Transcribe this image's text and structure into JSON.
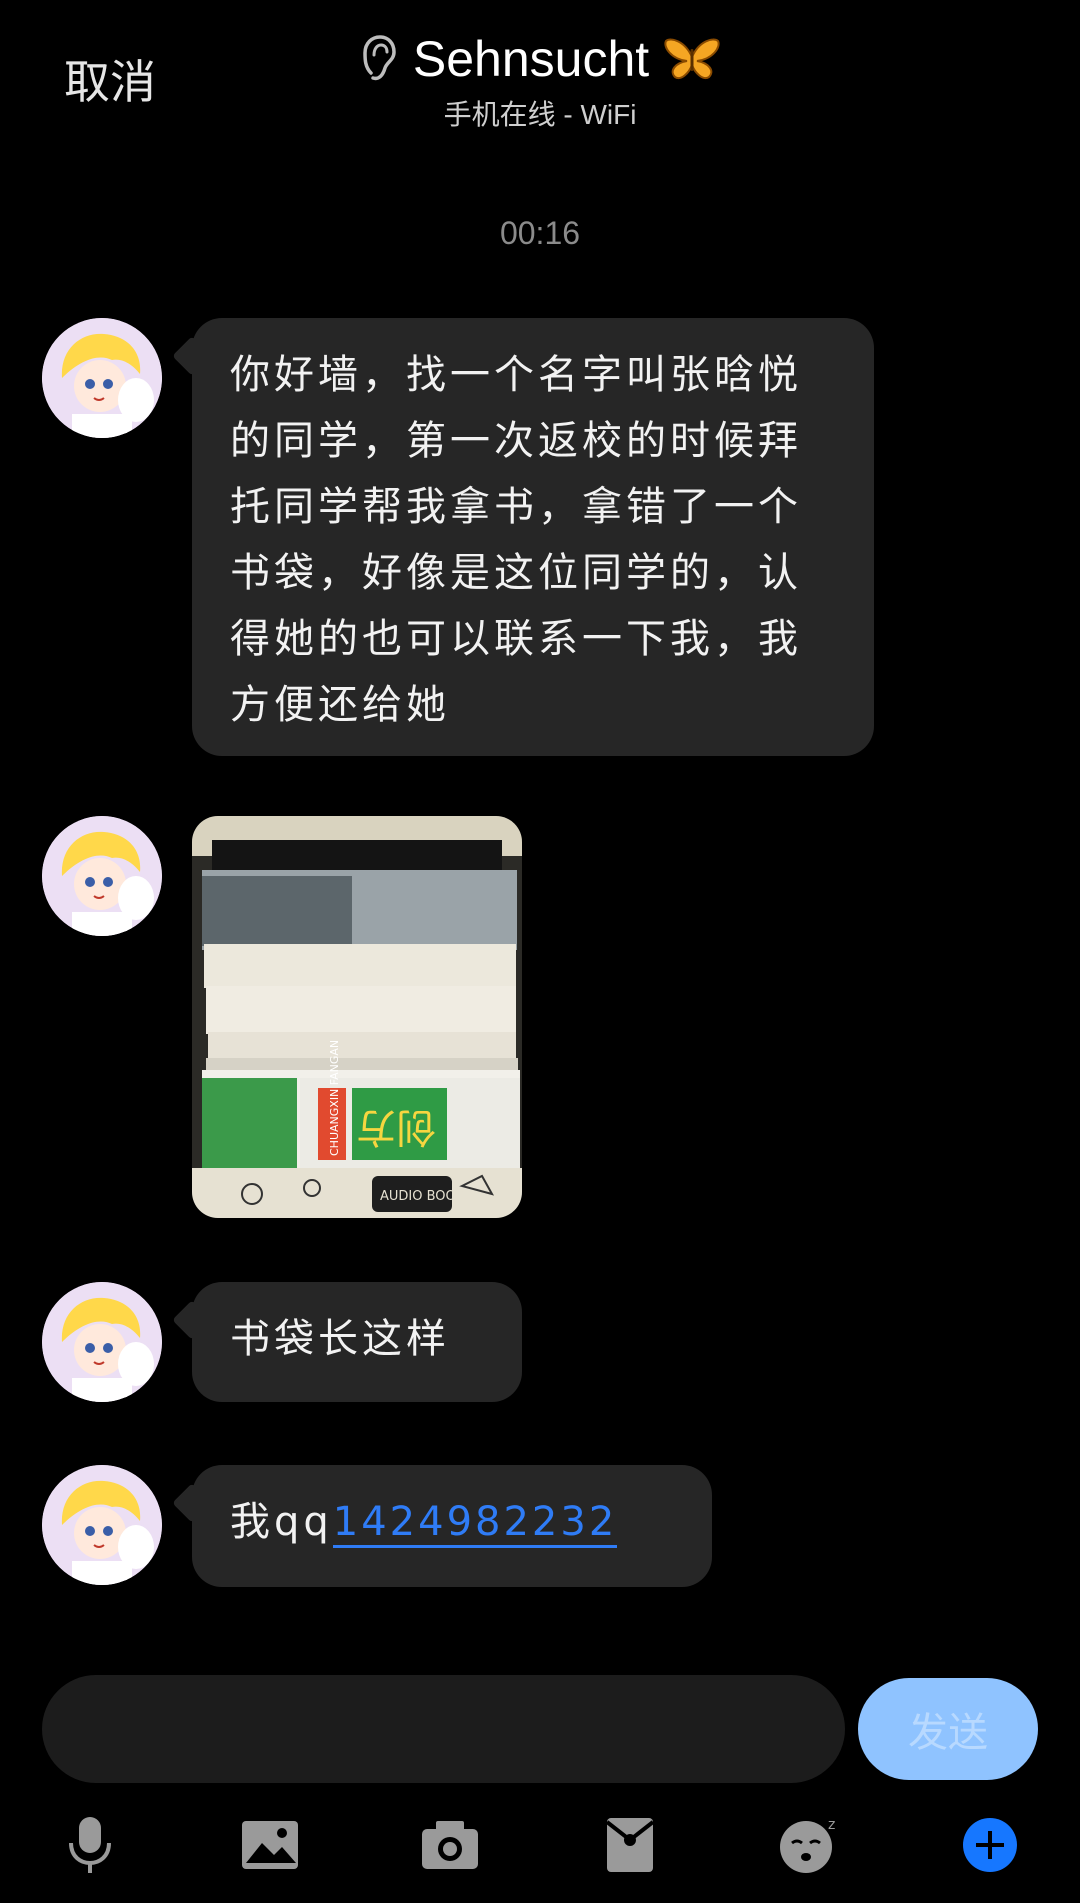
{
  "header": {
    "cancel_label": "取消",
    "title": "Sehnsucht",
    "subtitle": "手机在线 - WiFi"
  },
  "timestamp": "00:16",
  "messages": [
    {
      "type": "text",
      "text": "你好墙，找一个名字叫张晗悦的同学，第一次返校的时候拜托同学帮我拿书，拿错了一个书袋，好像是这位同学的，认得她的也可以联系一下我，我方便还给她"
    },
    {
      "type": "image",
      "image_text": [
        "CHUANGXIN FANGAN",
        "创方",
        "AUDIO BOOK"
      ]
    },
    {
      "type": "text",
      "text": "书袋长这样"
    },
    {
      "type": "text",
      "prefix": "我qq",
      "link": "1424982232"
    }
  ],
  "input": {
    "value": "",
    "placeholder": ""
  },
  "send_label": "发送",
  "toolbar": [
    "microphone-icon",
    "image-icon",
    "camera-icon",
    "red-packet-icon",
    "emoji-icon",
    "plus-icon"
  ],
  "colors": {
    "background": "#000000",
    "bubble": "#262626",
    "link": "#2f7cf6",
    "send_button": "#8fc3ff",
    "plus_button": "#1677ff"
  }
}
